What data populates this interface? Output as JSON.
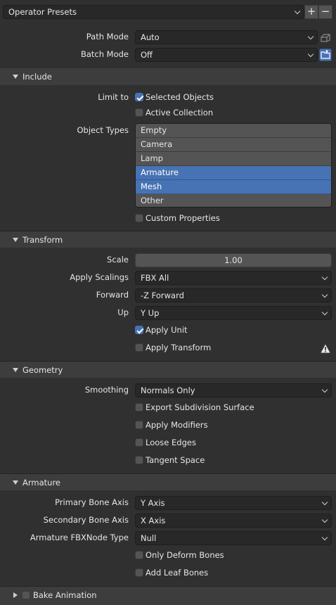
{
  "preset": {
    "value": "Operator Presets",
    "add_label": "+",
    "remove_label": "−"
  },
  "path_mode": {
    "label": "Path Mode",
    "value": "Auto"
  },
  "batch_mode": {
    "label": "Batch Mode",
    "value": "Off"
  },
  "include": {
    "title": "Include",
    "limit_to": {
      "label": "Limit to",
      "selected_objects": "Selected Objects",
      "active_collection": "Active Collection"
    },
    "object_types": {
      "label": "Object Types",
      "items": [
        "Empty",
        "Camera",
        "Lamp",
        "Armature",
        "Mesh",
        "Other"
      ]
    },
    "custom_properties": "Custom Properties"
  },
  "transform": {
    "title": "Transform",
    "scale": {
      "label": "Scale",
      "value": "1.00"
    },
    "apply_scalings": {
      "label": "Apply Scalings",
      "value": "FBX All"
    },
    "forward": {
      "label": "Forward",
      "value": "-Z Forward"
    },
    "up": {
      "label": "Up",
      "value": "Y Up"
    },
    "apply_unit": "Apply Unit",
    "apply_transform": "Apply Transform"
  },
  "geometry": {
    "title": "Geometry",
    "smoothing": {
      "label": "Smoothing",
      "value": "Normals Only"
    },
    "export_subdivision": "Export Subdivision Surface",
    "apply_modifiers": "Apply Modifiers",
    "loose_edges": "Loose Edges",
    "tangent_space": "Tangent Space"
  },
  "armature": {
    "title": "Armature",
    "primary_bone_axis": {
      "label": "Primary Bone Axis",
      "value": "Y Axis"
    },
    "secondary_bone_axis": {
      "label": "Secondary Bone Axis",
      "value": "X Axis"
    },
    "node_type": {
      "label": "Armature FBXNode Type",
      "value": "Null"
    },
    "only_deform_bones": "Only Deform Bones",
    "add_leaf_bones": "Add Leaf Bones"
  },
  "bake_animation": {
    "title": "Bake Animation"
  },
  "colors": {
    "accent": "#4772b3",
    "panel": "#303030",
    "header": "#3d3d3d"
  }
}
